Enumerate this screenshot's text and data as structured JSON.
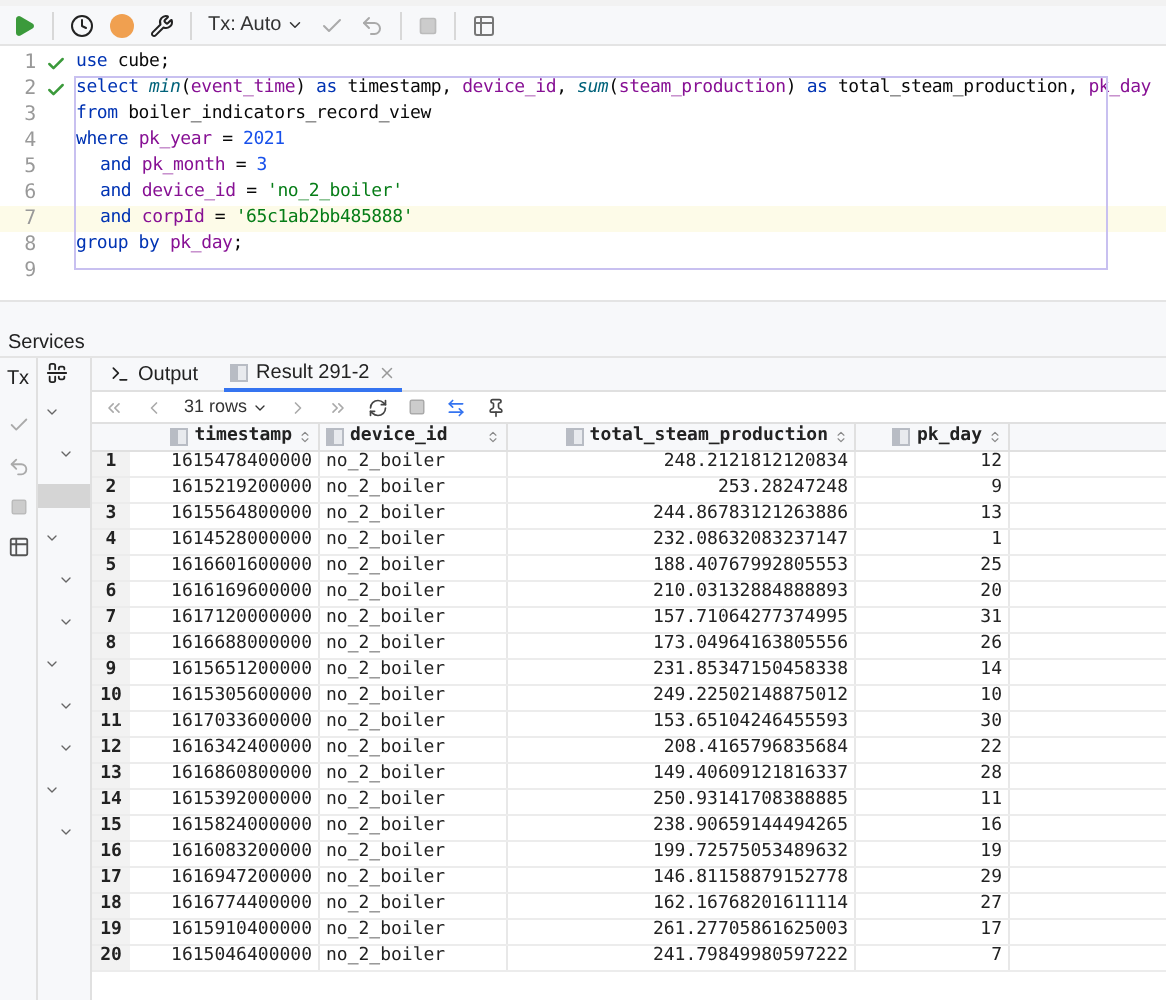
{
  "toolbar": {
    "tx_mode": "Tx: Auto"
  },
  "editor": {
    "lines": [
      {
        "number": "1",
        "check": true,
        "current": false,
        "tokens": [
          {
            "kind": "kw",
            "text": "use "
          },
          {
            "kind": "plain",
            "text": "cube;"
          }
        ]
      },
      {
        "number": "2",
        "check": true,
        "current": false,
        "tokens": [
          {
            "kind": "kw",
            "text": "select "
          },
          {
            "kind": "fn",
            "text": "min"
          },
          {
            "kind": "plain",
            "text": "("
          },
          {
            "kind": "id",
            "text": "event_time"
          },
          {
            "kind": "plain",
            "text": ") "
          },
          {
            "kind": "kw",
            "text": "as "
          },
          {
            "kind": "plain",
            "text": "timestamp, "
          },
          {
            "kind": "id",
            "text": "device_id"
          },
          {
            "kind": "plain",
            "text": ", "
          },
          {
            "kind": "fn",
            "text": "sum"
          },
          {
            "kind": "plain",
            "text": "("
          },
          {
            "kind": "id",
            "text": "steam_production"
          },
          {
            "kind": "plain",
            "text": ") "
          },
          {
            "kind": "kw",
            "text": "as "
          },
          {
            "kind": "plain",
            "text": "total_steam_production, "
          },
          {
            "kind": "id",
            "text": "pk_day"
          }
        ]
      },
      {
        "number": "3",
        "check": false,
        "current": false,
        "tokens": [
          {
            "kind": "kw",
            "text": "from "
          },
          {
            "kind": "plain",
            "text": "boiler_indicators_record_view"
          }
        ]
      },
      {
        "number": "4",
        "check": false,
        "current": false,
        "tokens": [
          {
            "kind": "kw",
            "text": "where "
          },
          {
            "kind": "id",
            "text": "pk_year "
          },
          {
            "kind": "plain",
            "text": "= "
          },
          {
            "kind": "num",
            "text": "2021"
          }
        ]
      },
      {
        "number": "5",
        "check": false,
        "current": false,
        "indented": true,
        "tokens": [
          {
            "kind": "kw",
            "text": "and "
          },
          {
            "kind": "id",
            "text": "pk_month "
          },
          {
            "kind": "plain",
            "text": "= "
          },
          {
            "kind": "num",
            "text": "3"
          }
        ]
      },
      {
        "number": "6",
        "check": false,
        "current": false,
        "indented": true,
        "tokens": [
          {
            "kind": "kw",
            "text": "and "
          },
          {
            "kind": "id",
            "text": "device_id "
          },
          {
            "kind": "plain",
            "text": "= "
          },
          {
            "kind": "str",
            "text": "'no_2_boiler'"
          }
        ]
      },
      {
        "number": "7",
        "check": false,
        "current": true,
        "indented": true,
        "tokens": [
          {
            "kind": "kw",
            "text": "and "
          },
          {
            "kind": "id",
            "text": "corpId "
          },
          {
            "kind": "plain",
            "text": "= "
          },
          {
            "kind": "str",
            "text": "'65c1ab2bb485888'"
          }
        ]
      },
      {
        "number": "8",
        "check": false,
        "current": false,
        "tokens": [
          {
            "kind": "kw",
            "text": "group by "
          },
          {
            "kind": "id",
            "text": "pk_day"
          },
          {
            "kind": "plain",
            "text": ";"
          }
        ]
      },
      {
        "number": "9",
        "check": false,
        "current": false
      }
    ]
  },
  "services": {
    "title": "Services",
    "side_label": "Tx",
    "tabs": [
      {
        "label": "Output",
        "selected": false
      },
      {
        "label": "Result 291-2",
        "selected": true
      }
    ],
    "rows_selector": "31 rows",
    "table": {
      "columns": [
        "",
        "timestamp",
        "device_id",
        "total_steam_production",
        "pk_day"
      ],
      "rows": [
        [
          "1",
          "1615478400000",
          "no_2_boiler",
          "248.2121812120834",
          "12"
        ],
        [
          "2",
          "1615219200000",
          "no_2_boiler",
          "253.28247248",
          "9"
        ],
        [
          "3",
          "1615564800000",
          "no_2_boiler",
          "244.86783121263886",
          "13"
        ],
        [
          "4",
          "1614528000000",
          "no_2_boiler",
          "232.08632083237147",
          "1"
        ],
        [
          "5",
          "1616601600000",
          "no_2_boiler",
          "188.40767992805553",
          "25"
        ],
        [
          "6",
          "1616169600000",
          "no_2_boiler",
          "210.03132884888893",
          "20"
        ],
        [
          "7",
          "1617120000000",
          "no_2_boiler",
          "157.71064277374995",
          "31"
        ],
        [
          "8",
          "1616688000000",
          "no_2_boiler",
          "173.04964163805556",
          "26"
        ],
        [
          "9",
          "1615651200000",
          "no_2_boiler",
          "231.85347150458338",
          "14"
        ],
        [
          "10",
          "1615305600000",
          "no_2_boiler",
          "249.22502148875012",
          "10"
        ],
        [
          "11",
          "1617033600000",
          "no_2_boiler",
          "153.65104246455593",
          "30"
        ],
        [
          "12",
          "1616342400000",
          "no_2_boiler",
          "208.4165796835684",
          "22"
        ],
        [
          "13",
          "1616860800000",
          "no_2_boiler",
          "149.40609121816337",
          "28"
        ],
        [
          "14",
          "1615392000000",
          "no_2_boiler",
          "250.93141708388885",
          "11"
        ],
        [
          "15",
          "1615824000000",
          "no_2_boiler",
          "238.90659144494265",
          "16"
        ],
        [
          "16",
          "1616083200000",
          "no_2_boiler",
          "199.72575053489632",
          "19"
        ],
        [
          "17",
          "1616947200000",
          "no_2_boiler",
          "146.81158879152778",
          "29"
        ],
        [
          "18",
          "1616774400000",
          "no_2_boiler",
          "162.16768201611114",
          "27"
        ],
        [
          "19",
          "1615910400000",
          "no_2_boiler",
          "261.27705861625003",
          "17"
        ],
        [
          "20",
          "1615046400000",
          "no_2_boiler",
          "241.79849980597222",
          "7"
        ]
      ]
    }
  }
}
